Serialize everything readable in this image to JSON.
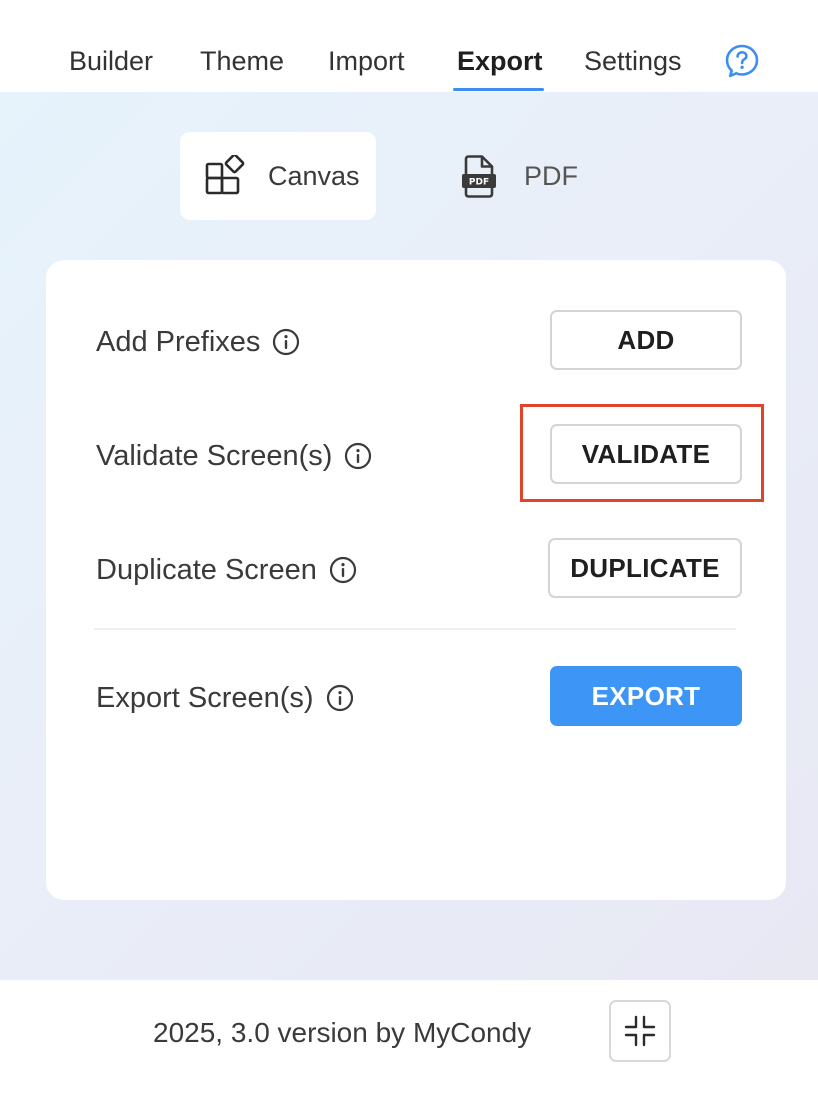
{
  "nav": {
    "tabs": [
      {
        "label": "Builder"
      },
      {
        "label": "Theme"
      },
      {
        "label": "Import"
      },
      {
        "label": "Export"
      },
      {
        "label": "Settings"
      }
    ],
    "active_tab": "Export",
    "help_icon": "question-circle-icon"
  },
  "modes": {
    "canvas_label": "Canvas",
    "canvas_icon": "canvas-icon",
    "pdf_label": "PDF",
    "pdf_icon": "pdf-file-icon",
    "active": "Canvas"
  },
  "actions": [
    {
      "label": "Add Prefixes",
      "button": "ADD"
    },
    {
      "label": "Validate Screen(s)",
      "button": "VALIDATE"
    },
    {
      "label": "Duplicate Screen",
      "button": "DUPLICATE"
    },
    {
      "label": "Export Screen(s)",
      "button": "EXPORT"
    }
  ],
  "footer": {
    "text": "2025, 3.0 version by MyCondy",
    "collapse_icon": "collapse-icon"
  },
  "colors": {
    "accent": "#3d95f5",
    "highlight": "#e0442c"
  }
}
